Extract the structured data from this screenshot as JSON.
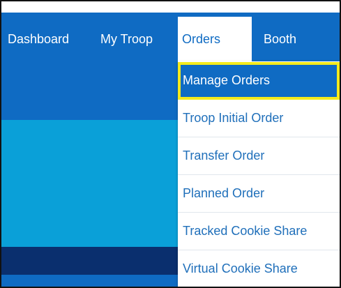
{
  "nav": {
    "items": [
      {
        "label": "Dashboard"
      },
      {
        "label": "My Troop"
      },
      {
        "label": "Orders",
        "active": true
      },
      {
        "label": "Booth"
      }
    ]
  },
  "orders_menu": {
    "items": [
      {
        "label": "Manage Orders",
        "highlighted": true
      },
      {
        "label": "Troop Initial Order"
      },
      {
        "label": "Transfer Order"
      },
      {
        "label": "Planned Order"
      },
      {
        "label": "Tracked Cookie Share"
      },
      {
        "label": "Virtual Cookie Share"
      }
    ]
  },
  "colors": {
    "navbar": "#0f6bc3",
    "highlight_border": "#f4ea1c",
    "menu_text": "#1f6fba",
    "hero": "#0aa0d8",
    "dark_band": "#0a2f6e"
  }
}
